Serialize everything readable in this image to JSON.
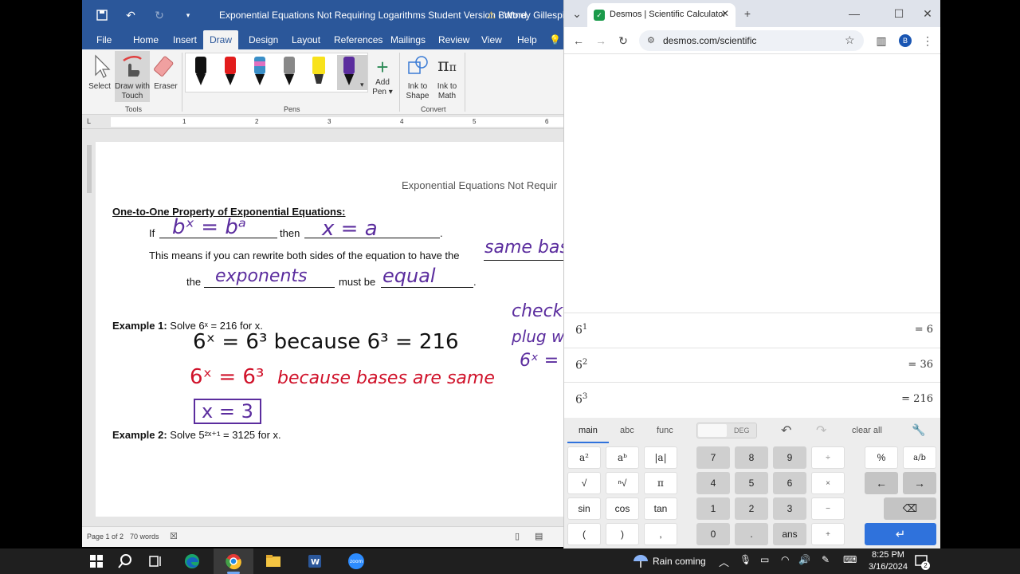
{
  "word": {
    "title": "Exponential Equations Not Requiring Logarithms Student Version  -  Word",
    "user": "Brittney Gillespie-Po",
    "tabs": [
      "File",
      "Home",
      "Insert",
      "Draw",
      "Design",
      "Layout",
      "References",
      "Mailings",
      "Review",
      "View",
      "Help"
    ],
    "ribbon": {
      "select": "Select",
      "draw_with": "Draw with",
      "touch": "Touch",
      "eraser": "Eraser",
      "tools_label": "Tools",
      "pens_label": "Pens",
      "add": "Add",
      "pen_menu": "Pen ▾",
      "ink_to_shape_1": "Ink to",
      "ink_to_shape_2": "Shape",
      "ink_to_math_1": "Ink to",
      "ink_to_math_2": "Math",
      "convert_label": "Convert"
    },
    "ruler_numbers": [
      "1",
      "2",
      "3",
      "4",
      "5",
      "6"
    ],
    "page": {
      "header": "Exponential Equations Not Requir",
      "heading": "One-to-One Property of Exponential Equations:",
      "if_label": "If",
      "then_label": "then",
      "period": ".",
      "means_text": "This means if you can rewrite both sides of the equation to have the",
      "the_label": "the",
      "must_be_label": "must be",
      "example1_label": "Example 1:",
      "example1_text": "Solve 6ˣ = 216 for x.",
      "example2_label": "Example 2:",
      "example2_text": "Solve 5²ˣ⁺¹ = 3125 for x."
    },
    "handwriting": {
      "blank1": "bˣ = bᵃ",
      "blank2": "x = a",
      "blank3": "same bas",
      "blank4": "exponents",
      "blank5": "equal",
      "margin1": "check",
      "margin2": "plug w",
      "margin3": "6ˣ =",
      "ex1_line1": "6ˣ = 6³  because  6³ = 216",
      "ex1_line2_eq": "6ˣ = 6³",
      "ex1_line2_note": "because  bases are same",
      "ex1_answer": "x = 3"
    },
    "status": {
      "page": "Page 1 of 2",
      "words": "70 words"
    }
  },
  "browser": {
    "tab_title": "Desmos | Scientific Calculator",
    "url": "desmos.com/scientific",
    "profile_initial": "B",
    "expressions": [
      {
        "base": "6",
        "exp": "1",
        "result": "= 6"
      },
      {
        "base": "6",
        "exp": "2",
        "result": "= 36"
      },
      {
        "base": "6",
        "exp": "3",
        "result": "= 216"
      }
    ],
    "keypad": {
      "tabs": [
        "main",
        "abc",
        "func"
      ],
      "deg": "DEG",
      "clear_all": "clear all",
      "keys": {
        "a2": "a²",
        "ab": "aᵇ",
        "abs": "|a|",
        "sqrt": "√",
        "nroot": "ⁿ√",
        "pi": "π",
        "sin": "sin",
        "cos": "cos",
        "tan": "tan",
        "lparen": "(",
        "rparen": ")",
        "comma": ",",
        "n7": "7",
        "n8": "8",
        "n9": "9",
        "div": "÷",
        "n4": "4",
        "n5": "5",
        "n6": "6",
        "mul": "×",
        "n1": "1",
        "n2": "2",
        "n3": "3",
        "minus": "−",
        "n0": "0",
        "dot": ".",
        "ans": "ans",
        "plus": "+",
        "percent": "%",
        "frac": "a/b",
        "left": "←",
        "right": "→",
        "backspace": "⌫",
        "enter": "↵"
      }
    }
  },
  "taskbar": {
    "weather": "Rain coming",
    "time": "8:25 PM",
    "date": "3/16/2024",
    "zoom_label": "zoom",
    "notification_count": "2"
  },
  "colors": {
    "word_blue": "#2b579a",
    "ink_purple": "#5b2d9e",
    "ink_red": "#d0122a",
    "desmos_blue": "#2f72dc"
  }
}
